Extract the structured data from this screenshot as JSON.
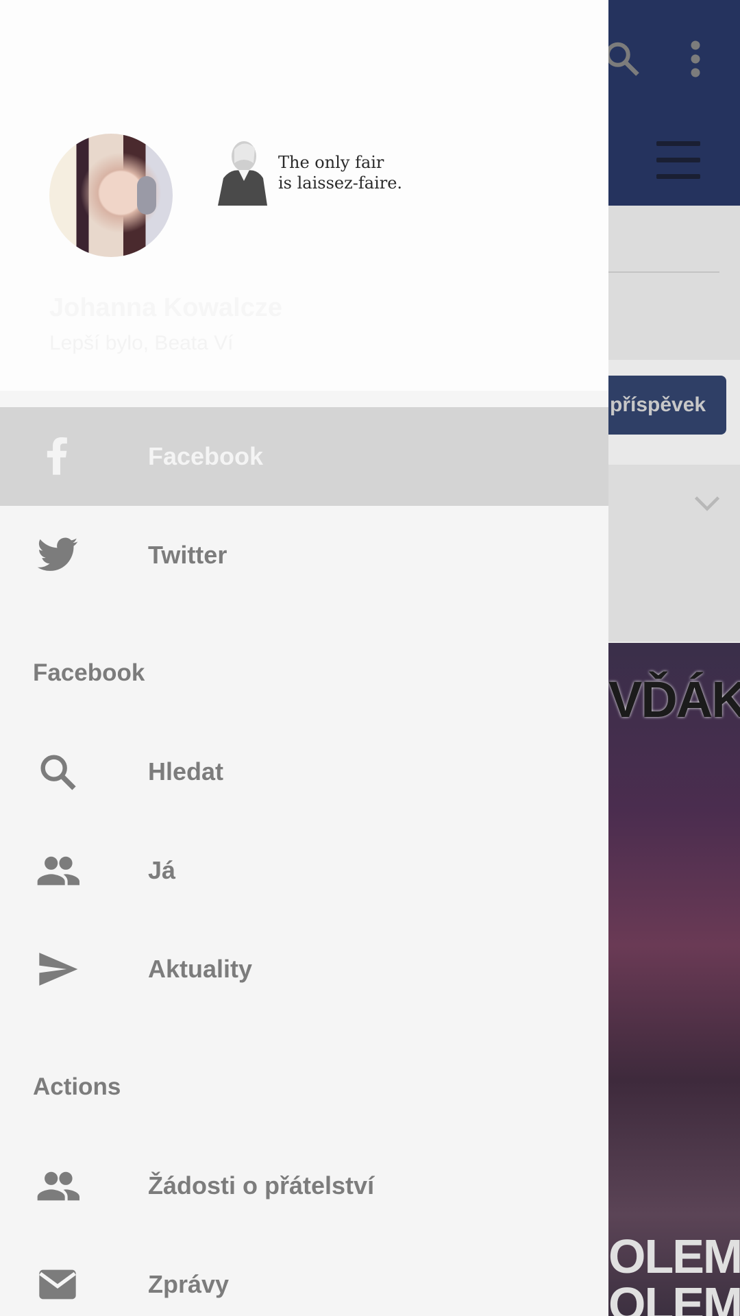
{
  "background_app": {
    "post_button_label": "příspěvek",
    "meme_top_text": "VĎÁK",
    "meme_bottom_text": "OLEM,\nOLEMI"
  },
  "profile": {
    "name": "Johanna Kowalcze",
    "subtitle": "Lepší bylo, Beata Ví",
    "cover_quote": "The only fair\nis laissez-faire."
  },
  "accounts": [
    {
      "label": "Facebook",
      "icon": "facebook-icon",
      "selected": true
    },
    {
      "label": "Twitter",
      "icon": "twitter-icon",
      "selected": false
    }
  ],
  "sections": [
    {
      "title": "Facebook",
      "items": [
        {
          "label": "Hledat",
          "icon": "search-icon"
        },
        {
          "label": "Já",
          "icon": "people-icon"
        },
        {
          "label": "Aktuality",
          "icon": "send-icon"
        }
      ]
    },
    {
      "title": "Actions",
      "items": [
        {
          "label": "Žádosti o přátelství",
          "icon": "people-icon"
        },
        {
          "label": "Zprávy",
          "icon": "mail-icon"
        }
      ]
    }
  ],
  "colors": {
    "header_blue": "#25335e",
    "drawer_bg": "#f5f5f5",
    "selected_bg": "#d4d4d4",
    "text_grey": "#7c7c7c"
  }
}
